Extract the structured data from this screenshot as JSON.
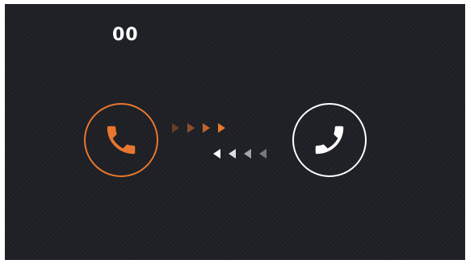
{
  "call": {
    "timer": "00"
  },
  "icons": {
    "caller": "phone-handset-icon",
    "callee": "phone-handset-icon",
    "outgoing": "chevron-right-icon",
    "incoming": "chevron-left-icon"
  },
  "colors": {
    "background": "#1f2126",
    "accent": "#e8772e",
    "foreground": "#ffffff"
  },
  "arrow_opacity": {
    "outgoing": [
      0.35,
      0.55,
      0.8,
      1.0
    ],
    "incoming": [
      1.0,
      0.85,
      0.6,
      0.4
    ]
  }
}
